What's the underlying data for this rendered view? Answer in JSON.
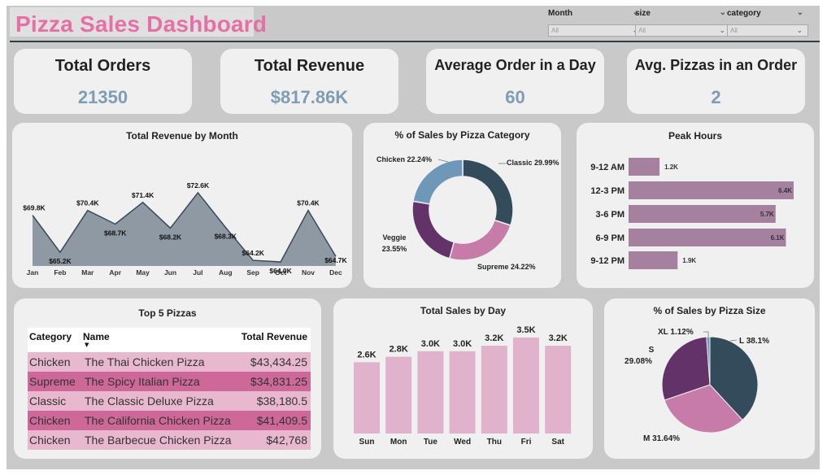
{
  "header": {
    "title": "Pizza Sales Dashboard"
  },
  "filters": [
    {
      "label": "Month",
      "value": "All"
    },
    {
      "label": "size",
      "value": "All"
    },
    {
      "label": "category",
      "value": "All"
    }
  ],
  "kpis": [
    {
      "title": "Total Orders",
      "value": "21350"
    },
    {
      "title": "Total Revenue",
      "value": "$817.86K"
    },
    {
      "title": "Average Order in a Day",
      "value": "60"
    },
    {
      "title": "Avg. Pizzas in an Order",
      "value": "2"
    }
  ],
  "top5": {
    "title": "Top 5 Pizzas",
    "columns": [
      "Category",
      "Name",
      "Total Revenue"
    ],
    "rows": [
      {
        "category": "Chicken",
        "name": "The Thai Chicken Pizza",
        "revenue": "$43,434.25"
      },
      {
        "category": "Supreme",
        "name": "The Spicy Italian Pizza",
        "revenue": "$34,831.25"
      },
      {
        "category": "Classic",
        "name": "The Classic Deluxe Pizza",
        "revenue": "$38,180.5"
      },
      {
        "category": "Chicken",
        "name": "The California Chicken Pizza",
        "revenue": "$41,409.5"
      },
      {
        "category": "Chicken",
        "name": "The Barbecue Chicken Pizza",
        "revenue": "$42,768"
      }
    ]
  },
  "colors": {
    "title_pink": "#e66fa6",
    "kpi_value": "#7e9db5",
    "area_fill": "#8e99a3",
    "area_line": "#3b4a56",
    "bar_mauve": "#a5809f",
    "bar_pink": "#e0b2cb",
    "slate": "#344b5b",
    "plum": "#633268",
    "pink": "#c77ba8",
    "steel_blue": "#6e97b8"
  },
  "chart_data": [
    {
      "type": "area",
      "title": "Total Revenue by Month",
      "categories": [
        "Jan",
        "Feb",
        "Mar",
        "Apr",
        "May",
        "Jun",
        "Jul",
        "Aug",
        "Sep",
        "Oct",
        "Nov",
        "Dec"
      ],
      "values": [
        69.8,
        65.2,
        70.4,
        68.7,
        71.4,
        68.2,
        72.6,
        68.3,
        64.2,
        64.0,
        70.4,
        64.7
      ],
      "labels": [
        "$69.8K",
        "$65.2K",
        "$70.4K",
        "$68.7K",
        "$71.4K",
        "$68.2K",
        "$72.6K",
        "$68.3K",
        "$64.2K",
        "$64.0K",
        "$70.4K",
        "$64.7K"
      ],
      "ylim": [
        63.5,
        73.5
      ]
    },
    {
      "type": "pie",
      "subtype": "donut",
      "title": "% of Sales by Pizza Category",
      "categories": [
        "Classic",
        "Supreme",
        "Veggie",
        "Chicken"
      ],
      "values": [
        29.99,
        24.22,
        23.55,
        22.24
      ],
      "labels": [
        "Classic 29.99%",
        "Supreme 24.22%",
        "Veggie",
        "23.55%",
        "Chicken 22.24%"
      ]
    },
    {
      "type": "bar",
      "orientation": "horizontal",
      "title": "Peak Hours",
      "categories": [
        "9-12 AM",
        "12-3 PM",
        "3-6 PM",
        "6-9 PM",
        "9-12 PM"
      ],
      "values": [
        1.2,
        6.4,
        5.7,
        6.1,
        1.9
      ],
      "labels": [
        "1.2K",
        "6.4K",
        "5.7K",
        "6.1K",
        "1.9K"
      ],
      "xlim": [
        0,
        6.4
      ]
    },
    {
      "type": "bar",
      "title": "Total Sales by Day",
      "categories": [
        "Sun",
        "Mon",
        "Tue",
        "Wed",
        "Thu",
        "Fri",
        "Sat"
      ],
      "values": [
        2.6,
        2.8,
        3.0,
        3.0,
        3.2,
        3.5,
        3.2
      ],
      "labels": [
        "2.6K",
        "2.8K",
        "3.0K",
        "3.0K",
        "3.2K",
        "3.5K",
        "3.2K"
      ],
      "ylim": [
        0,
        3.5
      ]
    },
    {
      "type": "pie",
      "title": "% of Sales by Pizza Size",
      "categories": [
        "L",
        "M",
        "S",
        "XL"
      ],
      "values": [
        38.1,
        31.64,
        29.08,
        1.12
      ],
      "labels": [
        "L 38.1%",
        "M 31.64%",
        "S",
        "29.08%",
        "XL 1.12%"
      ]
    }
  ]
}
